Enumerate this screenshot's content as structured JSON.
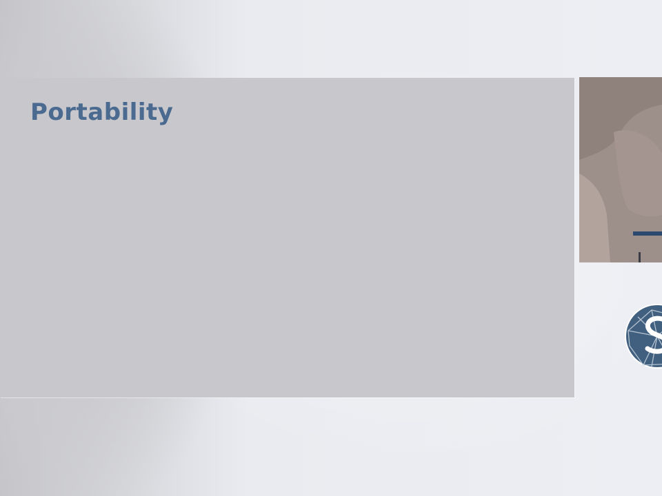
{
  "slide": {
    "title": "Portability"
  },
  "colors": {
    "title": "#4a6a90",
    "panel": "#c8c7cc",
    "background": "#e9ebf0",
    "logo": "#41607f"
  },
  "icons": {
    "logo": "globe-logo-icon",
    "photo": "speaker-video-thumbnail"
  }
}
